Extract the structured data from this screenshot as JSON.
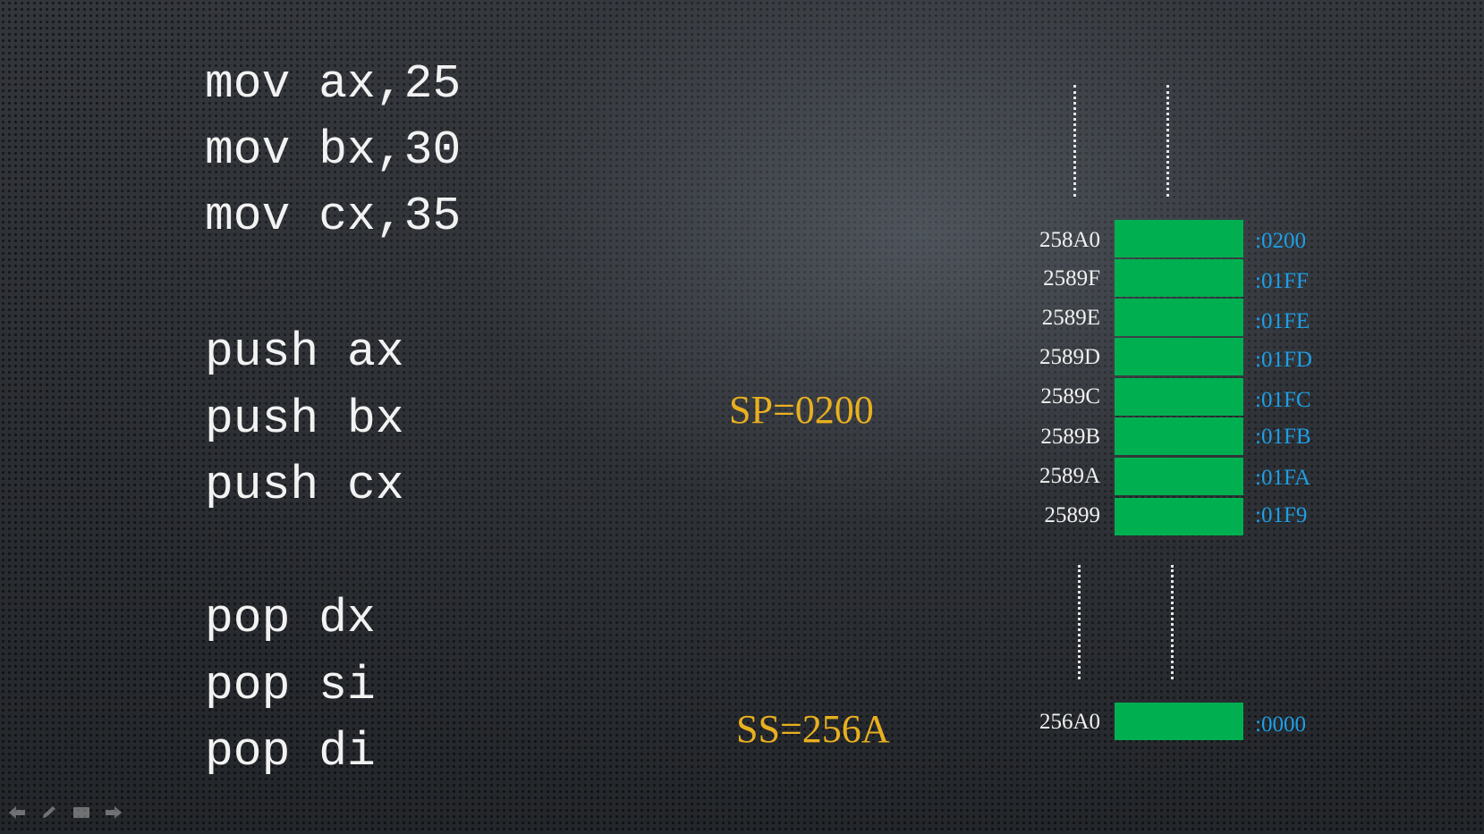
{
  "code": {
    "lines": [
      "mov ax,25",
      "mov bx,30",
      "mov cx,35",
      "push ax",
      "push bx",
      "push cx",
      "pop dx",
      "pop si",
      "pop di"
    ]
  },
  "registers": {
    "sp": "SP=0200",
    "ss": "SS=256A"
  },
  "stack": {
    "cells": [
      {
        "address": "258A0",
        "offset": ":0200"
      },
      {
        "address": "2589F",
        "offset": ":01FF"
      },
      {
        "address": "2589E",
        "offset": ":01FE"
      },
      {
        "address": "2589D",
        "offset": ":01FD"
      },
      {
        "address": "2589C",
        "offset": ":01FC"
      },
      {
        "address": "2589B",
        "offset": ":01FB"
      },
      {
        "address": "2589A",
        "offset": ":01FA"
      },
      {
        "address": "25899",
        "offset": ":01F9"
      }
    ],
    "bottom": {
      "address": "256A0",
      "offset": ":0000"
    }
  },
  "colors": {
    "cell": "#00b050",
    "register_label": "#e8b020",
    "offset": "#1e9fe6",
    "code": "#f2f2f2"
  },
  "nav": {
    "icons": [
      "arrow-left-icon",
      "pen-icon",
      "menu-icon",
      "arrow-right-icon"
    ]
  }
}
